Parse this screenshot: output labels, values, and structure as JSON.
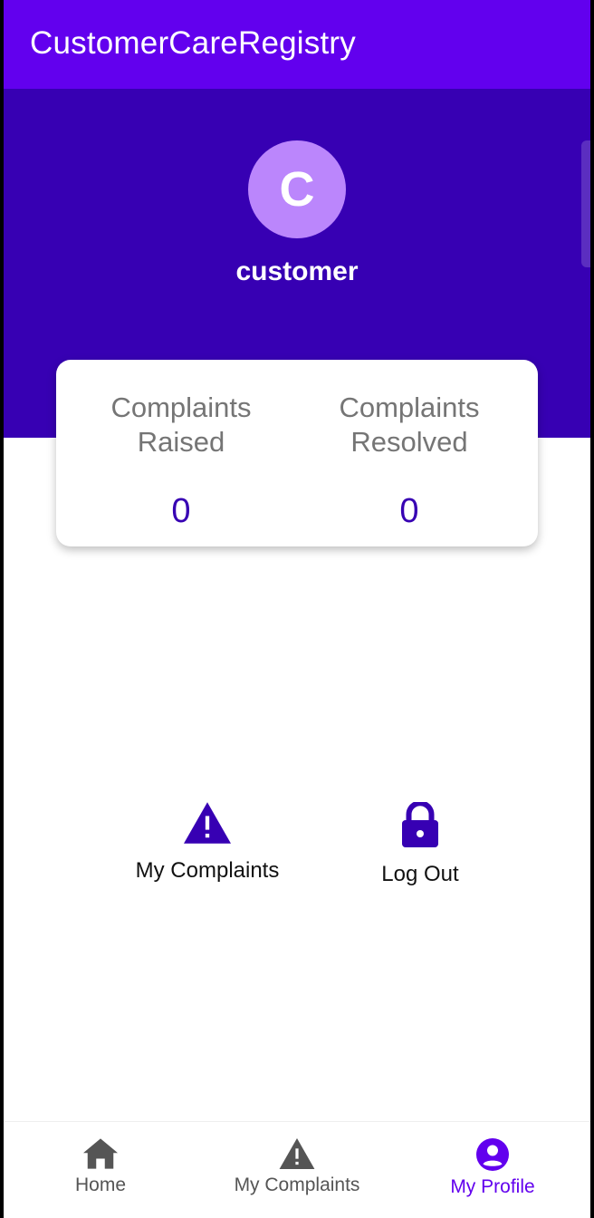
{
  "app_bar": {
    "title": "CustomerCareRegistry"
  },
  "profile": {
    "avatar_letter": "C",
    "username": "customer"
  },
  "stats": {
    "raised_label": "Complaints Raised",
    "raised_value": "0",
    "resolved_label": "Complaints Resolved",
    "resolved_value": "0"
  },
  "actions": {
    "complaints_label": "My Complaints",
    "complaints_icon": "warning-icon",
    "logout_label": "Log Out",
    "logout_icon": "lock-icon"
  },
  "bottom_nav": {
    "items": [
      {
        "label": "Home",
        "icon": "home-icon",
        "active": false
      },
      {
        "label": "My Complaints",
        "icon": "warning-icon",
        "active": false
      },
      {
        "label": "My Profile",
        "icon": "account-circle-icon",
        "active": true
      }
    ]
  },
  "colors": {
    "primary": "#6200ee",
    "primary_dark": "#3700b3",
    "avatar": "#bb86fc",
    "inactive_nav": "#555555"
  }
}
